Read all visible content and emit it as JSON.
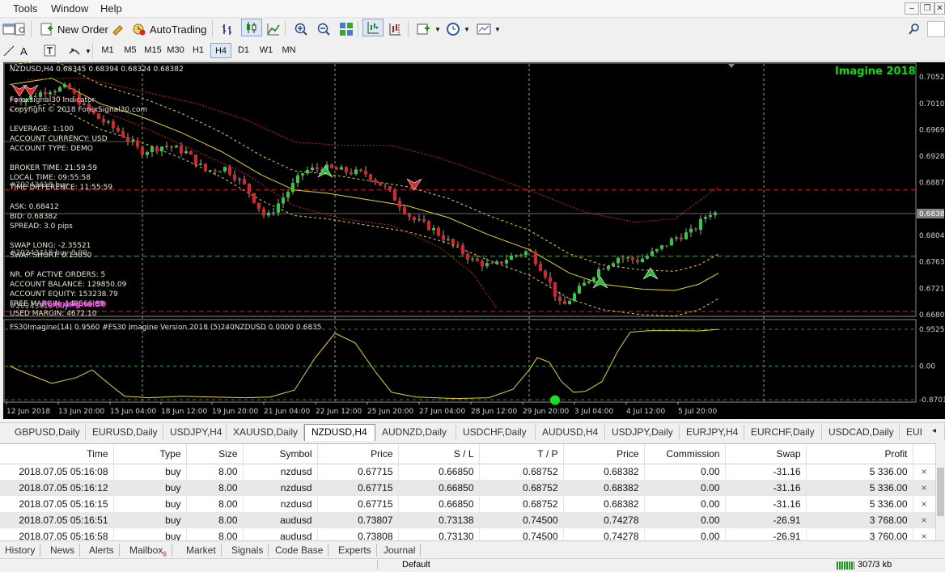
{
  "menu": [
    "Tools",
    "Window",
    "Help"
  ],
  "toolbar": {
    "new_order": "New Order",
    "autotrading": "AutoTrading"
  },
  "timeframes": [
    "M1",
    "M5",
    "M15",
    "M30",
    "H1",
    "H4",
    "D1",
    "W1",
    "MN"
  ],
  "active_timeframe": "H4",
  "chart": {
    "header": "NZDUSD,H4  0.68345 0.68394 0.68324 0.68382",
    "brand": "Imagine 2018",
    "indicator_name": "Forexsignal30 Indicator",
    "copyright": "Copyright © 2018 ForexSignal30.com",
    "leverage": "LEVERAGE:   1:100",
    "currency": "ACCOUNT CURRENCY:   USD",
    "account_type": "ACCOUNT TYPE:   DEMO",
    "broker_time": "BROKER TIME:   21:59:59",
    "local_time": "LOCAL TIME:   09:55:58",
    "time_diff": "TIME DIFFERENCE:   11:55:59",
    "ask": "ASK:   0.68412",
    "bid": "BID:   0.68382",
    "spread": "SPREAD:   3.0 pips",
    "swap_long": "SWAP LONG:   -2.35521",
    "swap_short": "SWAP SHORT:   0.13050",
    "active_orders": "NR. OF ACTIVE ORDERS:   5",
    "balance": "ACCOUNT BALANCE:   129850.09",
    "equity": "ACCOUNT EQUITY:   153238.79",
    "free_margin": "FREE MARGIN:   148566.69",
    "used_margin": "USED MARGIN:   4672.10",
    "overlay_a": "#20243418 buy",
    "overlay_b": "#20243418 buy 8.00",
    "overlay_c": "#20243418 buy",
    "overlay_d": "Forexsignal30",
    "indicator_header": "FS30Imagine(14) 0.9560  #FS30 Imagine Version 2018 (5)240NZDUSD 0.0000 0.6835",
    "price_labels": [
      "0.70520",
      "0.70100",
      "0.69690",
      "0.69280",
      "0.68870",
      "0.68382",
      "0.68040",
      "0.67630",
      "0.67210",
      "0.66800"
    ],
    "current_price": "0.68382",
    "ind_labels": [
      "0.9525",
      "0.00",
      "-0.8701"
    ],
    "time_labels": [
      "12 Jun 2018",
      "13 Jun 20:00",
      "15 Jun 04:00",
      "18 Jun 12:00",
      "19 Jun 20:00",
      "21 Jun 04:00",
      "22 Jun 12:00",
      "25 Jun 20:00",
      "27 Jun 04:00",
      "28 Jun 12:00",
      "29 Jun 20:00",
      "3 Jul 04:00",
      "4 Jul 12:00",
      "5 Jul 20:00"
    ]
  },
  "symbol_tabs": [
    "GBPUSD,Daily",
    "EURUSD,Daily",
    "USDJPY,H4",
    "XAUUSD,Daily",
    "NZDUSD,H4",
    "AUDNZD,Daily",
    "USDCHF,Daily",
    "AUDUSD,H4",
    "USDJPY,Daily",
    "EURJPY,H4",
    "EURCHF,Daily",
    "USDCAD,Daily",
    "EUI"
  ],
  "active_symbol_tab": "NZDUSD,H4",
  "trades": {
    "columns": [
      "Time",
      "Type",
      "Size",
      "Symbol",
      "Price",
      "S / L",
      "T / P",
      "Price",
      "Commission",
      "Swap",
      "Profit"
    ],
    "rows": [
      [
        "2018.07.05 05:16:08",
        "buy",
        "8.00",
        "nzdusd",
        "0.67715",
        "0.66850",
        "0.68752",
        "0.68382",
        "0.00",
        "-31.16",
        "5 336.00"
      ],
      [
        "2018.07.05 05:16:12",
        "buy",
        "8.00",
        "nzdusd",
        "0.67715",
        "0.66850",
        "0.68752",
        "0.68382",
        "0.00",
        "-31.16",
        "5 336.00"
      ],
      [
        "2018.07.05 05:16:15",
        "buy",
        "8.00",
        "nzdusd",
        "0.67715",
        "0.66850",
        "0.68752",
        "0.68382",
        "0.00",
        "-31.16",
        "5 336.00"
      ],
      [
        "2018.07.05 05:16:51",
        "buy",
        "8.00",
        "audusd",
        "0.73807",
        "0.73138",
        "0.74500",
        "0.74278",
        "0.00",
        "-26.91",
        "3 768.00"
      ],
      [
        "2018.07.05 05:16:58",
        "buy",
        "8.00",
        "audusd",
        "0.73808",
        "0.73130",
        "0.74500",
        "0.74278",
        "0.00",
        "-26.91",
        "3 760.00"
      ]
    ]
  },
  "bottom_tabs": [
    "History",
    "News",
    "Alerts",
    "Mailbox",
    "Market",
    "Signals",
    "Code Base",
    "Experts",
    "Journal"
  ],
  "mailbox_count": "6",
  "status": {
    "profile": "Default",
    "traffic": "307/3 kb"
  },
  "colors": {
    "bull": "#2ecc40",
    "bear": "#e0202a",
    "ma": "#e8d800",
    "outer_band": "#d01818",
    "price_line": "#6a6a6a",
    "brand": "#00e000"
  }
}
